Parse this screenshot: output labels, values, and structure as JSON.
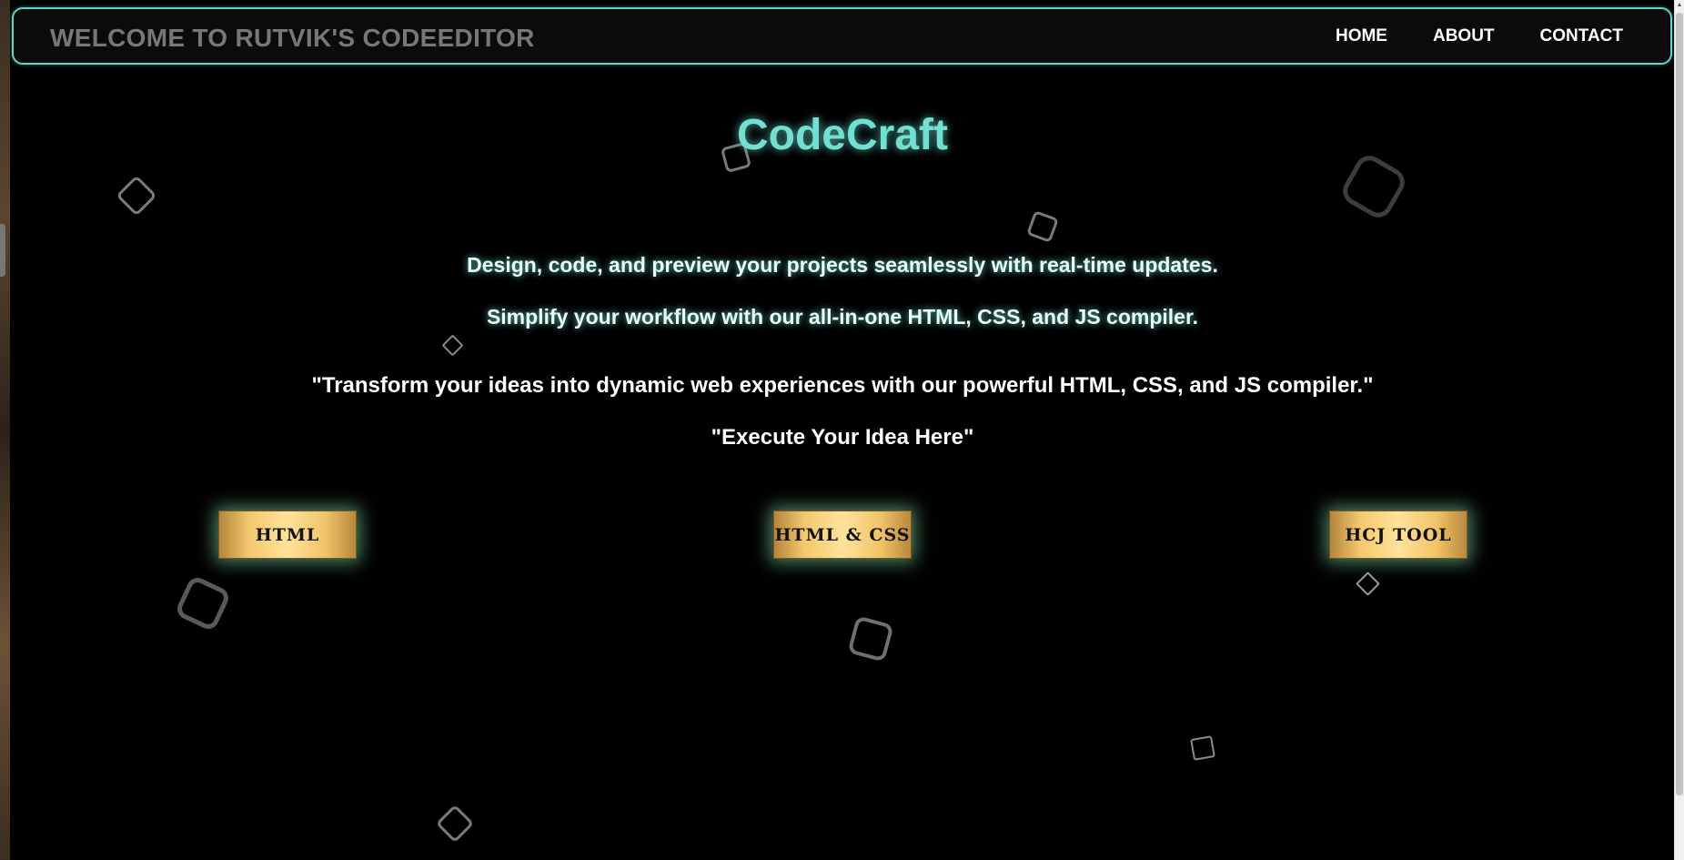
{
  "navbar": {
    "brand": "WELCOME TO RUTVIK'S CODEEDITOR",
    "links": [
      "HOME",
      "ABOUT",
      "CONTACT"
    ]
  },
  "hero": {
    "title": "CodeCraft",
    "tagline_1": "Design, code, and preview your projects seamlessly with real-time updates.",
    "tagline_2": "Simplify your workflow with our all-in-one HTML, CSS, and JS compiler.",
    "quote": "\"Transform your ideas into dynamic web experiences with our powerful HTML, CSS, and JS compiler.\"",
    "cta_text": "\"Execute Your Idea Here\""
  },
  "buttons": {
    "html": "HTML",
    "html_css": "HTML & CSS",
    "hcj_tool": "HCJ TOOL"
  },
  "colors": {
    "accent": "#6fe0d2",
    "background": "#000000",
    "button_gold": "#f3c86e",
    "shape_outline": "#6d6d6d"
  }
}
